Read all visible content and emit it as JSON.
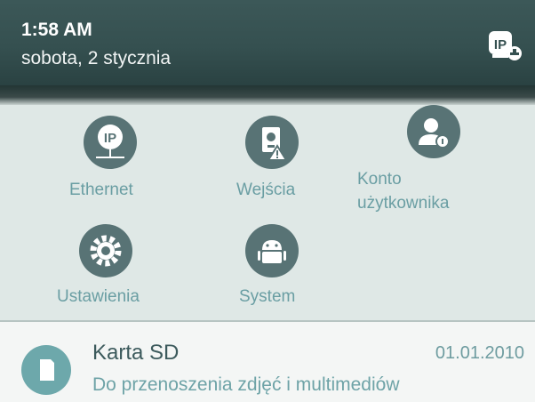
{
  "status_bar": {
    "time": "1:58 AM",
    "date": "sobota, 2 stycznia",
    "badge_icon": "ip-camera-icon",
    "badge_text": "IP"
  },
  "quick_settings": {
    "tiles": [
      {
        "label": "Ethernet",
        "icon": "ip-network-icon",
        "icon_text": "IP"
      },
      {
        "label": "Wejścia",
        "icon": "input-warning-icon"
      },
      {
        "label": "Konto",
        "label_line2": "użytkownika",
        "icon": "user-account-icon"
      },
      {
        "label": "Ustawienia",
        "icon": "gear-icon"
      },
      {
        "label": "System",
        "icon": "android-icon"
      }
    ]
  },
  "notification": {
    "icon": "sd-card-icon",
    "title": "Karta SD",
    "date": "01.01.2010",
    "description": "Do przenoszenia zdjęć i multimediów"
  },
  "colors": {
    "status_bar": "#355050",
    "panel": "#dfe8e6",
    "icon_bg": "#587375",
    "label": "#6a9ea3",
    "sd_icon": "#6da8ab"
  }
}
